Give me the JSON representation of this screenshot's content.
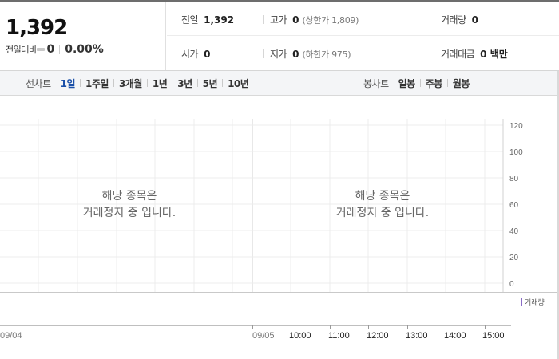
{
  "quote": {
    "price": "1,392",
    "change_label": "전일대비",
    "change_value": "0",
    "change_rate": "0.00%"
  },
  "stats": {
    "prev_close": {
      "label": "전일",
      "value": "1,392"
    },
    "high": {
      "label": "고가",
      "value": "0",
      "limit_text": "(상한가 1,809)"
    },
    "volume": {
      "label": "거래량",
      "value": "0"
    },
    "open": {
      "label": "시가",
      "value": "0"
    },
    "low": {
      "label": "저가",
      "value": "0",
      "limit_text": "(하한가 975)"
    },
    "trade_amount": {
      "label": "거래대금",
      "value": "0 백만"
    }
  },
  "line_chart_tabs": {
    "label": "선차트",
    "items": [
      "1일",
      "1주일",
      "3개월",
      "1년",
      "3년",
      "5년",
      "10년"
    ],
    "active_index": 0
  },
  "candle_chart_tabs": {
    "label": "봉차트",
    "items": [
      "일봉",
      "주봉",
      "월봉"
    ]
  },
  "messages": {
    "left": [
      "해당 종목은",
      "거래정지 중 입니다."
    ],
    "right": [
      "해당 종목은",
      "거래정지 중 입니다."
    ]
  },
  "volume_legend": "거래량",
  "colors": {
    "active_tab": "#1a4fa8",
    "volume": "#8a6cc7",
    "grid": "#ececec"
  },
  "chart_data": {
    "type": "line",
    "y_ticks": [
      0,
      20,
      40,
      60,
      80,
      100,
      120
    ],
    "ylim": [
      0,
      120
    ],
    "x_labels": [
      "09/04",
      "09/05",
      "10:00",
      "11:00",
      "12:00",
      "13:00",
      "14:00",
      "15:00"
    ],
    "series": [],
    "grid": true
  }
}
